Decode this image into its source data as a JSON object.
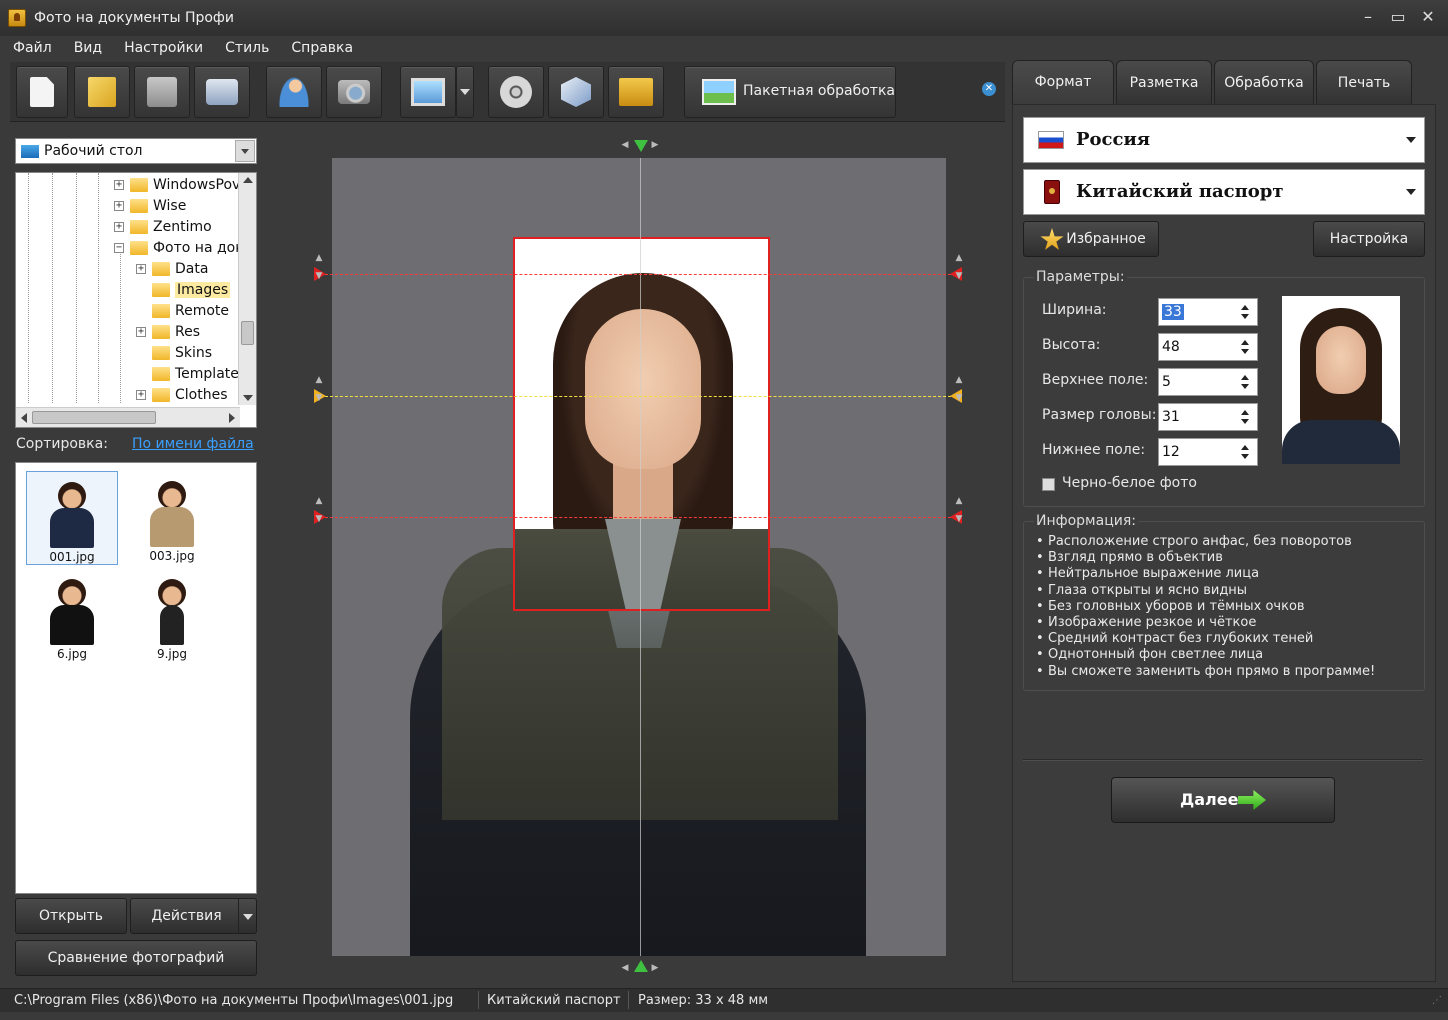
{
  "window": {
    "title": "Фото на документы Профи",
    "controls": [
      "–",
      "▭",
      "✕"
    ]
  },
  "menu": [
    "Файл",
    "Вид",
    "Настройки",
    "Стиль",
    "Справка"
  ],
  "toolbar": {
    "icons": [
      "new-document-icon",
      "open-folder-icon",
      "save-icon",
      "print-icon",
      "person-photo-icon",
      "camera-icon",
      "photo-frame-icon",
      "film-reel-icon",
      "package-box-icon",
      "cart-icon"
    ],
    "batch_label": "Пакетная обработка"
  },
  "browser": {
    "folder": "Рабочий стол",
    "tree": [
      {
        "label": "WindowsPov",
        "expander": "+",
        "level": 0,
        "selected": false
      },
      {
        "label": "Wise",
        "expander": "+",
        "level": 0,
        "selected": false
      },
      {
        "label": "Zentimo",
        "expander": "+",
        "level": 0,
        "selected": false
      },
      {
        "label": "Фото на док",
        "expander": "−",
        "level": 0,
        "selected": false
      },
      {
        "label": "Data",
        "expander": "+",
        "level": 1,
        "selected": false
      },
      {
        "label": "Images",
        "expander": "",
        "level": 1,
        "selected": true
      },
      {
        "label": "Remote",
        "expander": "",
        "level": 1,
        "selected": false
      },
      {
        "label": "Res",
        "expander": "+",
        "level": 1,
        "selected": false
      },
      {
        "label": "Skins",
        "expander": "",
        "level": 1,
        "selected": false
      },
      {
        "label": "Template",
        "expander": "",
        "level": 1,
        "selected": false
      },
      {
        "label": "Clothes",
        "expander": "+",
        "level": 1,
        "selected": false
      }
    ],
    "sort_label": "Сортировка:",
    "sort_value": "По имени файла",
    "thumbnails": [
      {
        "name": "001.jpg",
        "selected": true
      },
      {
        "name": "003.jpg",
        "selected": false
      },
      {
        "name": "6.jpg",
        "selected": false
      },
      {
        "name": "9.jpg",
        "selected": false
      }
    ],
    "open_label": "Открыть",
    "actions_label": "Действия",
    "compare_label": "Сравнение фотографий"
  },
  "tabs": [
    "Формат",
    "Разметка",
    "Обработка",
    "Печать"
  ],
  "format": {
    "country": "Россия",
    "document": "Китайский паспорт",
    "favorites_label": "Избранное",
    "settings_label": "Настройка",
    "params_title": "Параметры:",
    "params": [
      {
        "label": "Ширина:",
        "value": "33"
      },
      {
        "label": "Высота:",
        "value": "48"
      },
      {
        "label": "Верхнее поле:",
        "value": "5"
      },
      {
        "label": "Размер головы:",
        "value": "31"
      },
      {
        "label": "Нижнее поле:",
        "value": "12"
      }
    ],
    "bw_label": "Черно-белое фото",
    "bw_checked": false,
    "info_title": "Информация:",
    "info": [
      "Расположение строго анфас, без поворотов",
      "Взгляд прямо в объектив",
      "Нейтральное выражение лица",
      "Глаза открыты и ясно видны",
      "Без головных уборов и тёмных очков",
      "Изображение резкое и чёткое",
      "Средний контраст без глубоких теней",
      "Однотонный фон светлее лица",
      "Вы сможете заменить фон прямо в программе!"
    ],
    "next_label": "Далее"
  },
  "status": {
    "path": "C:\\Program Files (x86)\\Фото на документы Профи\\Images\\001.jpg",
    "document": "Китайский паспорт",
    "size": "Размер: 33 x 48 мм"
  },
  "colors": {
    "guide_red": "#ff3a3a",
    "guide_yellow": "#f0e040",
    "marker_green": "#40c040",
    "link_blue": "#3aa0ff"
  }
}
